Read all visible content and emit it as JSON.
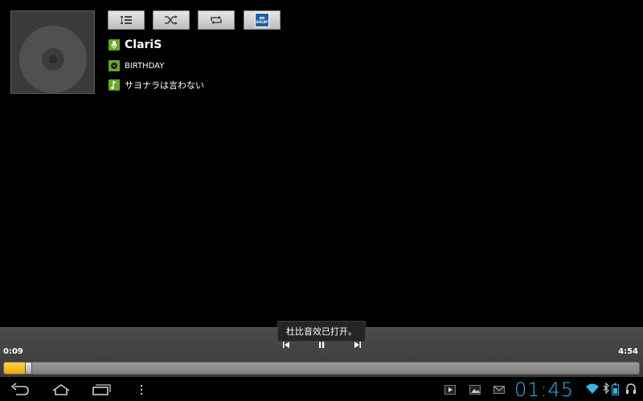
{
  "track": {
    "artist": "ClariS",
    "album": "BIRTHDAY",
    "title": "サヨナラは言わない"
  },
  "toolbar": {
    "buttons": [
      "playlist-icon",
      "shuffle-icon",
      "repeat-icon",
      "dolby-icon"
    ],
    "dolby_label": "DOLBY"
  },
  "toast": {
    "message": "杜比音效已打开。"
  },
  "playback": {
    "current_time": "0:09",
    "total_time": "4:54",
    "progress_fraction": 0.036
  },
  "status": {
    "clock": "01:45"
  },
  "colors": {
    "accent": "#39b3e6",
    "progress": "#f1a800",
    "info_icon": "#6aa626",
    "dolby": "#1f5fa5"
  }
}
